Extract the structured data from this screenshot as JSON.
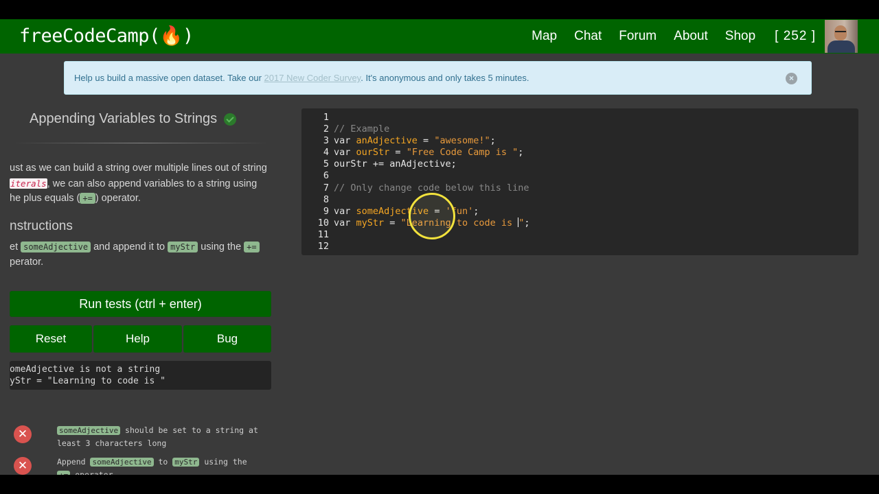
{
  "navbar": {
    "brand": "freeCodeCamp(🔥)",
    "items": [
      "Map",
      "Chat",
      "Forum",
      "About",
      "Shop"
    ],
    "points": "[ 252 ]"
  },
  "banner": {
    "text_before": "Help us build a massive open dataset. Take our ",
    "link": "2017 New Coder Survey",
    "text_after": ". It's anonymous and only takes 5 minutes.",
    "close": "×"
  },
  "lesson": {
    "title": "Appending Variables to Strings",
    "desc_1": "ust as we can build a string over multiple lines out of string ",
    "desc_code": "iterals",
    "desc_2": ", we can also append variables to a string using ",
    "desc_3": "he plus equals (",
    "desc_op": "+=",
    "desc_4": ") operator.",
    "instructions_heading": "nstructions",
    "instr_1": "et ",
    "instr_code1": "someAdjective",
    "instr_2": " and append it to ",
    "instr_code2": "myStr",
    "instr_3": " using the ",
    "instr_op": "+=",
    "instr_4": "perator."
  },
  "buttons": {
    "run": "Run tests (ctrl + enter)",
    "reset": "Reset",
    "help": "Help",
    "bug": "Bug"
  },
  "output": "omeAdjective is not a string\nyStr = \"Learning to code is \"",
  "tests": [
    {
      "code": "someAdjective",
      "text": " should be set to a string at least 3 characters long"
    },
    {
      "pre": "Append ",
      "code1": "someAdjective",
      "mid": " to ",
      "code2": "myStr",
      "post": " using the",
      "tail": "operator"
    }
  ],
  "editor": {
    "line_numbers": [
      "1",
      "2",
      "3",
      "4",
      "5",
      "6",
      "7",
      "8",
      "9",
      "10",
      "11",
      "12"
    ],
    "lines": [
      "",
      "// Example",
      "var anAdjective = \"awesome!\";",
      "var ourStr = \"Free Code Camp is \";",
      "ourStr += anAdjective;",
      "",
      "// Only change code below this line",
      "",
      "var someAdjective = 'fun';",
      "var myStr = \"Learning to code is \";",
      "",
      ""
    ]
  }
}
